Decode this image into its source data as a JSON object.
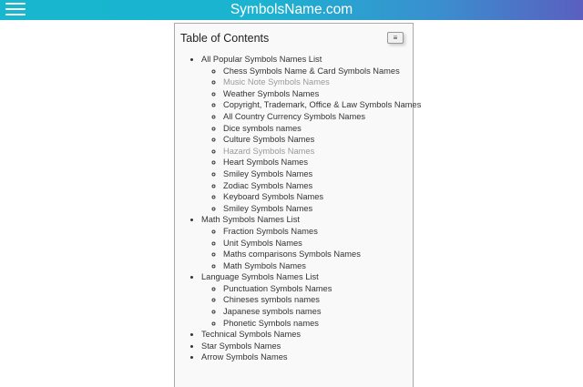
{
  "header": {
    "site_title": "SymbolsName.com",
    "menu_icon": "hamburger-menu-icon",
    "gradient_colors": [
      "#17b7cf",
      "#3a8fcf",
      "#5a5fbf"
    ]
  },
  "toc": {
    "title": "Table of Contents",
    "toggle_icon": "list-toggle-icon",
    "toggle_glyph": "≡",
    "sections": [
      {
        "label": "All Popular Symbols Names List",
        "items": [
          {
            "label": "Chess Symbols Name & Card Symbols Names",
            "visited": false
          },
          {
            "label": "Music Note Symbols Names",
            "visited": true
          },
          {
            "label": "Weather Symbols Names",
            "visited": false
          },
          {
            "label": "Copyright, Trademark, Office & Law Symbols Names",
            "visited": false
          },
          {
            "label": "All Country Currency Symbols Names",
            "visited": false
          },
          {
            "label": "Dice symbols names",
            "visited": false
          },
          {
            "label": "Culture Symbols Names",
            "visited": false
          },
          {
            "label": "Hazard Symbols Names",
            "visited": true
          },
          {
            "label": "Heart Symbols Names",
            "visited": false
          },
          {
            "label": "Smiley Symbols Names",
            "visited": false
          },
          {
            "label": "Zodiac Symbols Names",
            "visited": false
          },
          {
            "label": "Keyboard Symbols Names",
            "visited": false
          },
          {
            "label": "Smiley Symbols Names",
            "visited": false
          }
        ]
      },
      {
        "label": "Math Symbols Names List",
        "items": [
          {
            "label": "Fraction Symbols Names",
            "visited": false
          },
          {
            "label": "Unit Symbols Names",
            "visited": false
          },
          {
            "label": "Maths comparisons Symbols Names",
            "visited": false
          },
          {
            "label": "Math Symbols Names",
            "visited": false
          }
        ]
      },
      {
        "label": "Language Symbols Names List",
        "items": [
          {
            "label": "Punctuation Symbols Names",
            "visited": false
          },
          {
            "label": "Chineses symbols names",
            "visited": false
          },
          {
            "label": "Japanese symbols names",
            "visited": false
          },
          {
            "label": "Phonetic Symbols names",
            "visited": false
          }
        ]
      },
      {
        "label": "Technical Symbols Names",
        "items": []
      },
      {
        "label": "Star Symbols Names",
        "items": []
      },
      {
        "label": "Arrow Symbols Names",
        "items": []
      }
    ]
  }
}
